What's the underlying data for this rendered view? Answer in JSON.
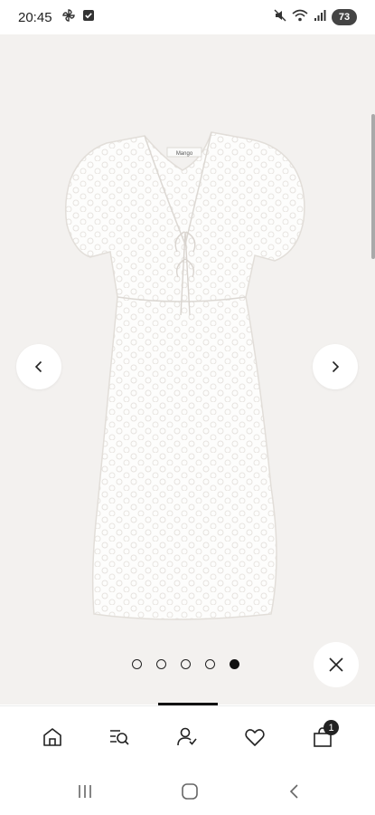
{
  "status_bar": {
    "time": "20:45",
    "battery": "73",
    "left_icons": [
      "pinwheel-icon",
      "checkbox-notification-icon"
    ],
    "right_icons": [
      "mute-vibrate-icon",
      "wifi-icon",
      "signal-icon",
      "battery-icon"
    ]
  },
  "gallery": {
    "product_image": "white-dress-photo",
    "page_count": 5,
    "active_page": 5,
    "brand_label": "Mango"
  },
  "bottom_nav": {
    "items": [
      {
        "icon": "home-icon"
      },
      {
        "icon": "search-icon"
      },
      {
        "icon": "account-icon"
      },
      {
        "icon": "heart-icon"
      },
      {
        "icon": "bag-icon",
        "badge": "1"
      }
    ]
  },
  "system_nav": {
    "items": [
      "recents-icon",
      "home-icon",
      "back-icon"
    ]
  },
  "colors": {
    "background": "#f3f1ef",
    "surface": "#ffffff",
    "ink": "#111111",
    "battery": "#444444"
  }
}
